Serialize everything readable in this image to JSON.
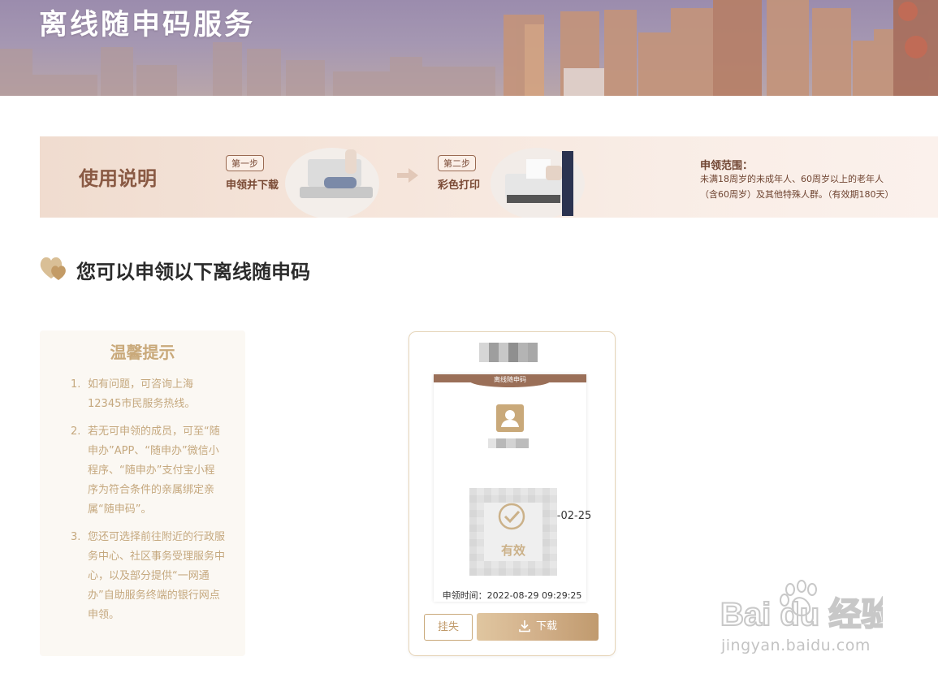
{
  "banner": {
    "title": "离线随申码服务"
  },
  "guide": {
    "title": "使用说明",
    "step1_badge": "第一步",
    "step1_text": "申领并下载",
    "step2_badge": "第二步",
    "step2_text": "彩色打印",
    "scope_title": "申领范围：",
    "scope_line1": "未满18周岁的未成年人、60周岁以上的老年人",
    "scope_line2": "（含60周岁）及其他特殊人群。（有效期180天）"
  },
  "section": {
    "title": "您可以申领以下离线随申码"
  },
  "tips": {
    "title": "温馨提示",
    "items": [
      {
        "num": "1.",
        "text": "如有问题，可咨询上海12345市民服务热线。"
      },
      {
        "num": "2.",
        "text": "若无可申领的成员，可至“随申办”APP、“随申办”微信小程序、“随申办”支付宝小程序为符合条件的亲属绑定亲属“随申码”。"
      },
      {
        "num": "3.",
        "text": "您还可选择前往附近的行政服务中心、社区事务受理服务中心，以及部分提供“一网通办”自助服务终端的银行网点申领。"
      }
    ]
  },
  "card": {
    "header": "离线随申码",
    "valid_until": "有效期至：2023-02-25",
    "qr_status": "有效",
    "apply_time": "申领时间：2022-08-29 09:29:25",
    "btn_lost": "挂失",
    "btn_download": "下载"
  },
  "watermark": {
    "logo_text": "Bai du 经验",
    "url": "jingyan.baidu.com"
  },
  "colors": {
    "accent_gold": "#c9a97a",
    "brown_text": "#7a4a35",
    "header_brown": "#9a6f58"
  }
}
